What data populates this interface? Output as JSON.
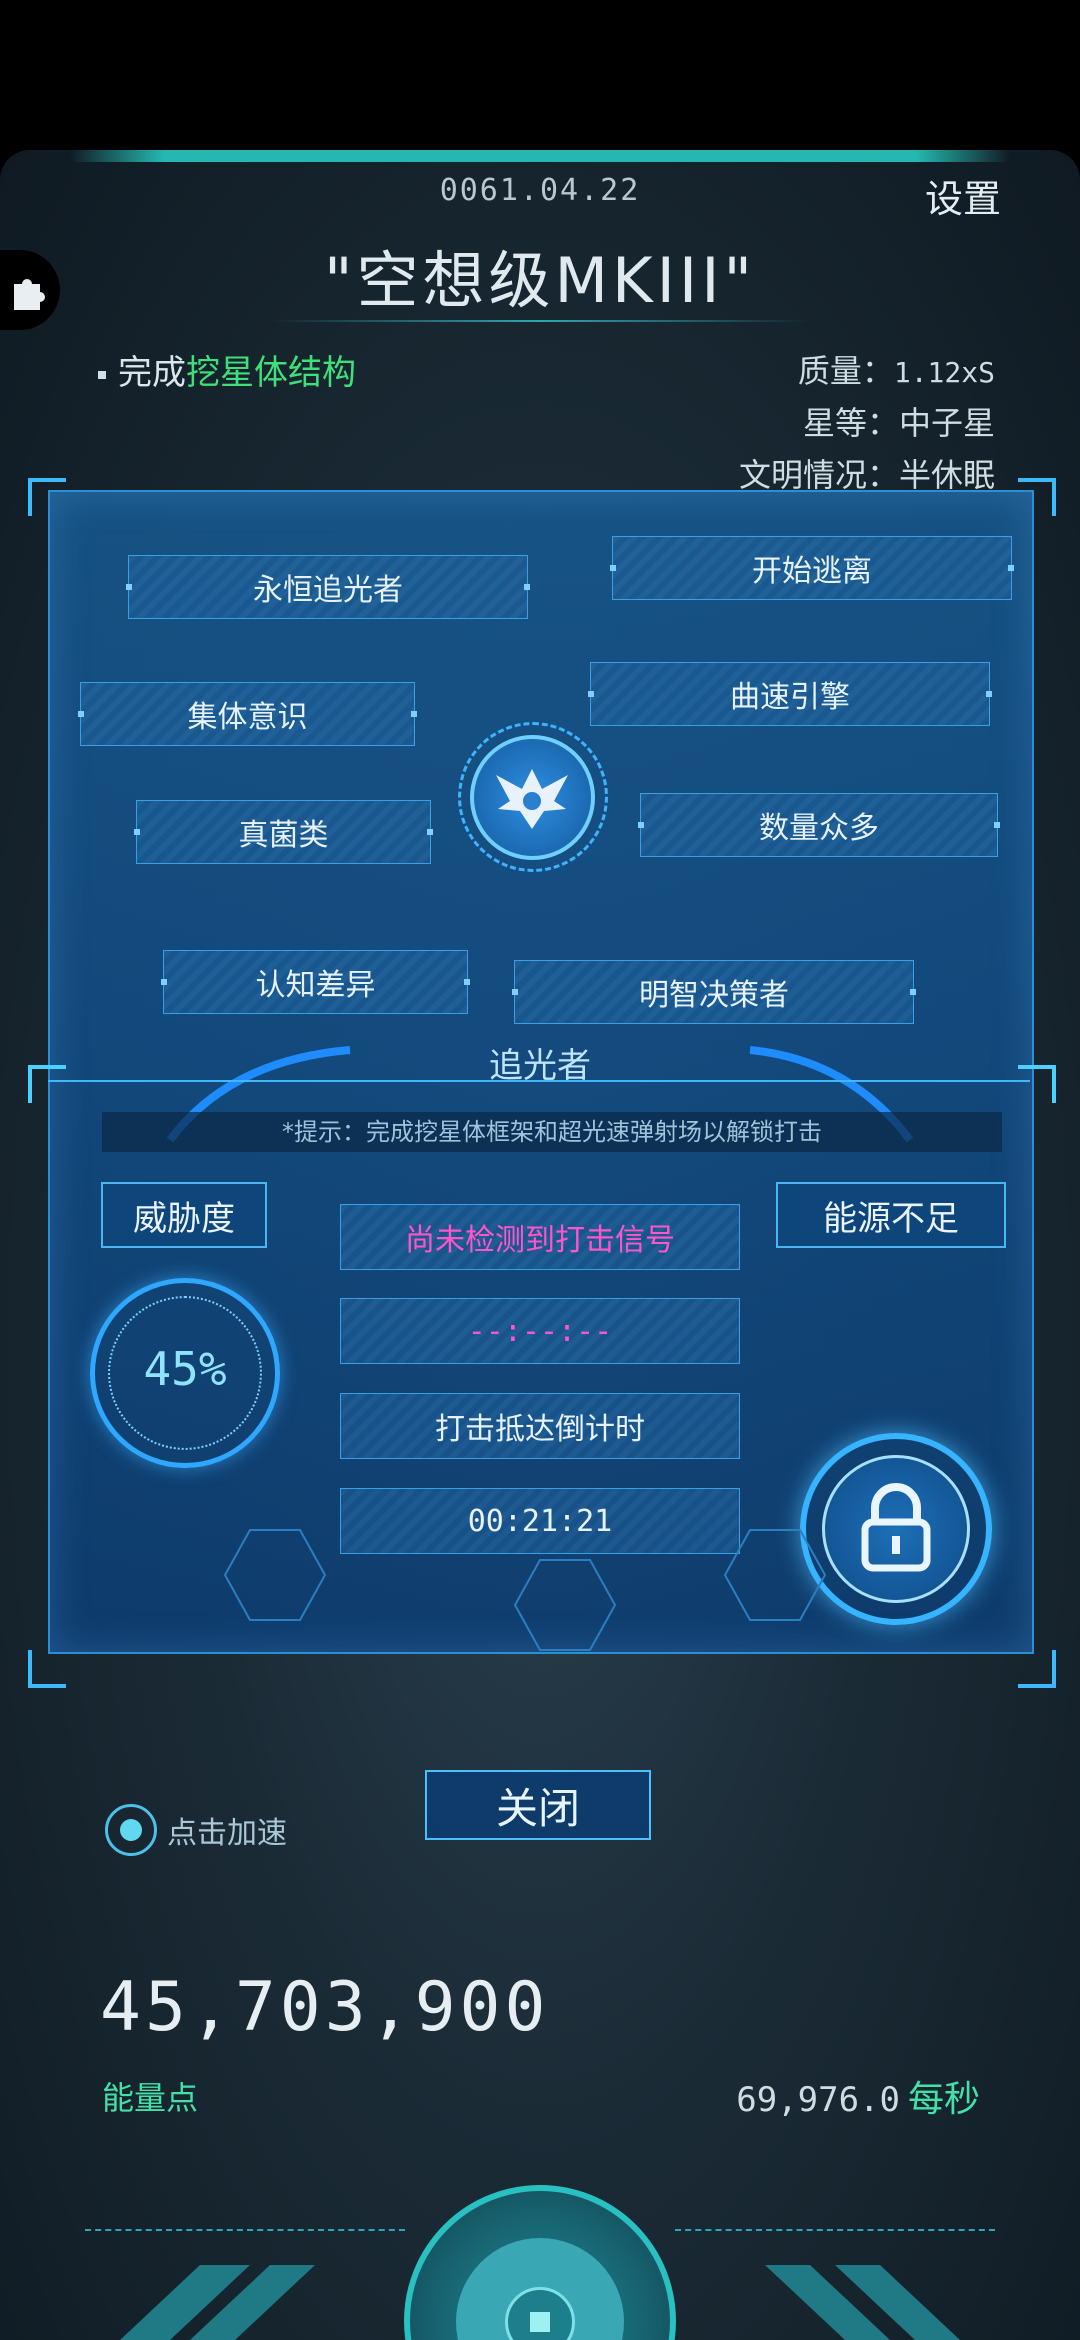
{
  "header": {
    "date": "0061.04.22",
    "settings_label": "设置",
    "ship_name": "\"空想级MKIII\""
  },
  "mission": {
    "prefix": "完成",
    "highlight": "挖星体结构"
  },
  "stats": {
    "mass_label": "质量：",
    "mass_value": "1.12xS",
    "rank_label": "星等：",
    "rank_value": "中子星",
    "civ_label": "文明情况：",
    "civ_value": "半休眠"
  },
  "traits": [
    "永恒追光者",
    "开始逃离",
    "集体意识",
    "曲速引擎",
    "真菌类",
    "数量众多",
    "认知差异",
    "明智决策者"
  ],
  "emblem": {
    "label": "追光者",
    "icon": "winged-emblem-icon"
  },
  "strike": {
    "hint": "*提示：完成挖星体框架和超光速弹射场以解锁打击",
    "threat_label": "威胁度",
    "threat_value": "45%",
    "threat_percent": 45,
    "energy_status": "能源不足",
    "signal_status": "尚未检测到打击信号",
    "signal_time": "--:--:--",
    "countdown_label": "打击抵达倒计时",
    "countdown_value": "00:21:21",
    "lock_icon": "lock-icon"
  },
  "close_label": "关闭",
  "speed_label": "点击加速",
  "energy": {
    "value": "45,703,900",
    "label": "能量点",
    "rate": "69,976.0",
    "rate_unit": "每秒"
  },
  "colors": {
    "accent_teal": "#28c0c0",
    "mission_highlight": "#3fe07a",
    "panel_blue": "#175c96",
    "signal_pink": "#ff55c8"
  }
}
